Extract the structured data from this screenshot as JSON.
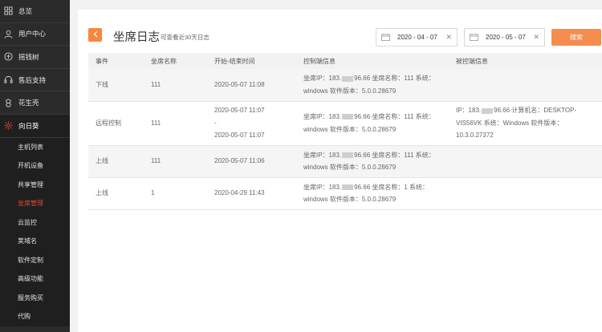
{
  "sidebar": {
    "main_items": [
      {
        "label": "总览",
        "icon": "grid-icon"
      },
      {
        "label": "用户中心",
        "icon": "user-icon"
      },
      {
        "label": "摇钱树",
        "icon": "tree-icon"
      },
      {
        "label": "售后支持",
        "icon": "headset-icon"
      },
      {
        "label": "花生壳",
        "icon": "peanut-icon"
      },
      {
        "label": "向日葵",
        "icon": "sunflower-icon"
      }
    ],
    "sub_items": [
      {
        "label": "主机列表"
      },
      {
        "label": "开机设备"
      },
      {
        "label": "共享管理"
      },
      {
        "label": "坐席管理"
      },
      {
        "label": "云监控"
      },
      {
        "label": "荚域名"
      },
      {
        "label": "软件定制"
      },
      {
        "label": "高级功能"
      },
      {
        "label": "服务购买"
      },
      {
        "label": "代购"
      }
    ],
    "active_sub_index": 3,
    "accent_color": "#e8452c"
  },
  "header": {
    "title": "坐席日志",
    "subtitle": "可查看近30天日志",
    "back_icon": "chevron-left-icon"
  },
  "filters": {
    "start_date": "2020 - 04 - 07",
    "end_date": "2020 - 05 - 07",
    "search_label": "搜索",
    "search_color": "#f58d4e"
  },
  "table": {
    "headers": [
      "事件",
      "坐席名称",
      "开始-结束时间",
      "控制端信息",
      "被控端信息"
    ],
    "rows": [
      {
        "event": "下线",
        "seat": "111",
        "time_start": "2020-05-07 11:08",
        "time_sep": "",
        "time_end": "",
        "ctrl_ip_prefix": "坐席IP：183.",
        "ctrl_ip_suffix": "96.66 坐席名称：111 系统：",
        "ctrl_line2": "windows 软件版本：5.0.0.28679",
        "target_line1_prefix": "",
        "target_line1_suffix": "",
        "target_line2": "",
        "target_line3": ""
      },
      {
        "event": "远程控制",
        "seat": "111",
        "time_start": "2020-05-07 11:07",
        "time_sep": "-",
        "time_end": "2020-05-07 11:07",
        "ctrl_ip_prefix": "坐席IP：183.",
        "ctrl_ip_suffix": "96.66 坐席名称：111 系统：",
        "ctrl_line2": "windows 软件版本：5.0.0.28679",
        "target_line1_prefix": "IP：183.",
        "target_line1_suffix": "96.66 计算机名：DESKTOP-",
        "target_line2": "VIS56VK 系统：Windows 软件版本：",
        "target_line3": "10.3.0.27372"
      },
      {
        "event": "上线",
        "seat": "111",
        "time_start": "2020-05-07 11:06",
        "time_sep": "",
        "time_end": "",
        "ctrl_ip_prefix": "坐席IP：183.",
        "ctrl_ip_suffix": "96.66 坐席名称：111 系统：",
        "ctrl_line2": "windows 软件版本：5.0.0.28679",
        "target_line1_prefix": "",
        "target_line1_suffix": "",
        "target_line2": "",
        "target_line3": ""
      },
      {
        "event": "上线",
        "seat": "1",
        "time_start": "2020-04-29 11:43",
        "time_sep": "",
        "time_end": "",
        "ctrl_ip_prefix": "坐席IP：183.",
        "ctrl_ip_suffix": "96.66 坐席名称：1 系统：",
        "ctrl_line2": "windows 软件版本：5.0.0.28679",
        "target_line1_prefix": "",
        "target_line1_suffix": "",
        "target_line2": "",
        "target_line3": ""
      }
    ]
  }
}
